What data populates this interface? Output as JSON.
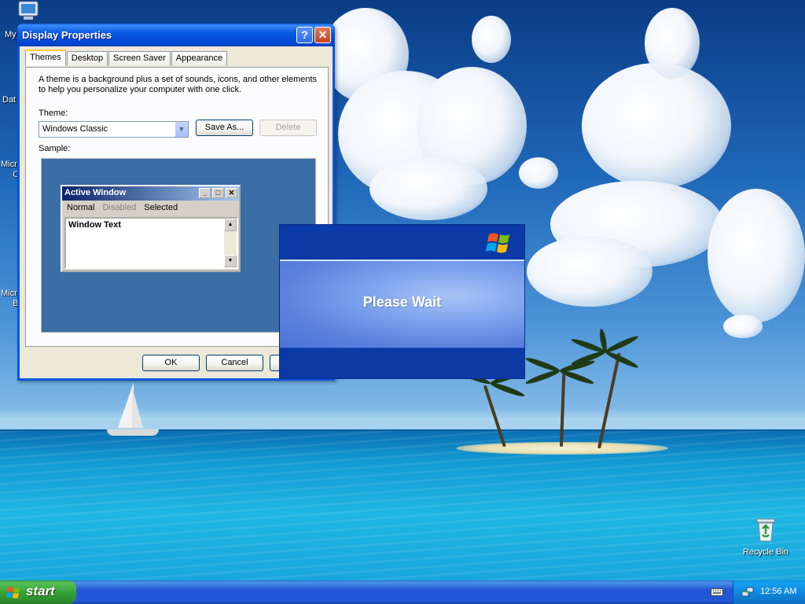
{
  "window": {
    "title": "Display Properties",
    "tabs": [
      "Themes",
      "Desktop",
      "Screen Saver",
      "Appearance"
    ],
    "description": "A theme is a background plus a set of sounds, icons, and other elements to help you personalize your computer with one click.",
    "theme_label": "Theme:",
    "theme_value": "Windows Classic",
    "save_as": "Save As...",
    "delete": "Delete",
    "sample_label": "Sample:",
    "sample": {
      "title": "Active Window",
      "menu": [
        "Normal",
        "Disabled",
        "Selected"
      ],
      "text": "Window Text"
    },
    "ok": "OK",
    "cancel": "Cancel"
  },
  "splash": {
    "text": "Please Wait"
  },
  "desktop": {
    "icons": {
      "my": "My",
      "recycle_bin": "Recycle Bin"
    },
    "cut_labels": {
      "dat": "Dat",
      "micro_c": "Micro\nC",
      "micro_b": "Micro\nB"
    }
  },
  "taskbar": {
    "start": "start",
    "clock": "12:56 AM"
  },
  "colors": {
    "xp_blue": "#0a54e3",
    "start_green": "#37a337",
    "classic_title": "#0a246a",
    "sample_bg": "#3a6ea5"
  }
}
